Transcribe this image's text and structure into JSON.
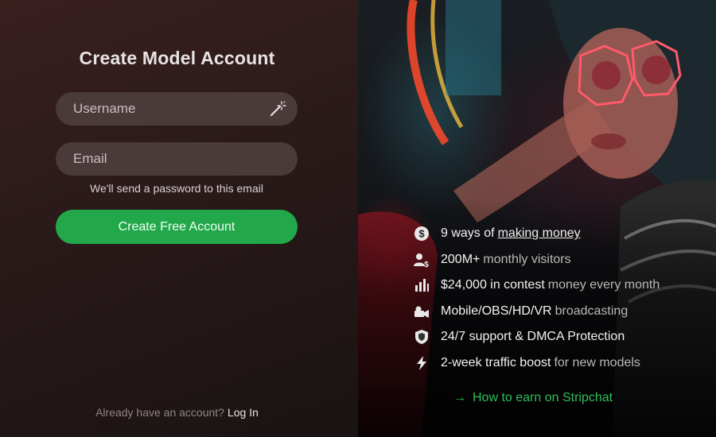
{
  "form": {
    "title": "Create Model Account",
    "username_placeholder": "Username",
    "email_placeholder": "Email",
    "email_hint": "We'll send a password to this email",
    "submit_label": "Create Free Account",
    "login_prompt": "Already have an account?",
    "login_link": "Log In"
  },
  "features": [
    {
      "icon": "dollar-icon",
      "strong": "9 ways of",
      "link": "making money",
      "muted": ""
    },
    {
      "icon": "users-dollar-icon",
      "strong": "200M+",
      "link": "",
      "muted": "monthly visitors"
    },
    {
      "icon": "chart-icon",
      "strong": "$24,000 in contest",
      "link": "",
      "muted": "money every month"
    },
    {
      "icon": "camera-icon",
      "strong": "Mobile/OBS/HD/VR",
      "link": "",
      "muted": "broadcasting"
    },
    {
      "icon": "shield-icon",
      "strong": "24/7 support & DMCA Protection",
      "link": "",
      "muted": ""
    },
    {
      "icon": "lightning-icon",
      "strong": "2-week traffic boost",
      "link": "",
      "muted": "for new models"
    }
  ],
  "earn_link": "How to earn on Stripchat",
  "colors": {
    "accent_green": "#22a84a",
    "link_green": "#2fbf5a",
    "field_bg": "#4a3a3a"
  }
}
